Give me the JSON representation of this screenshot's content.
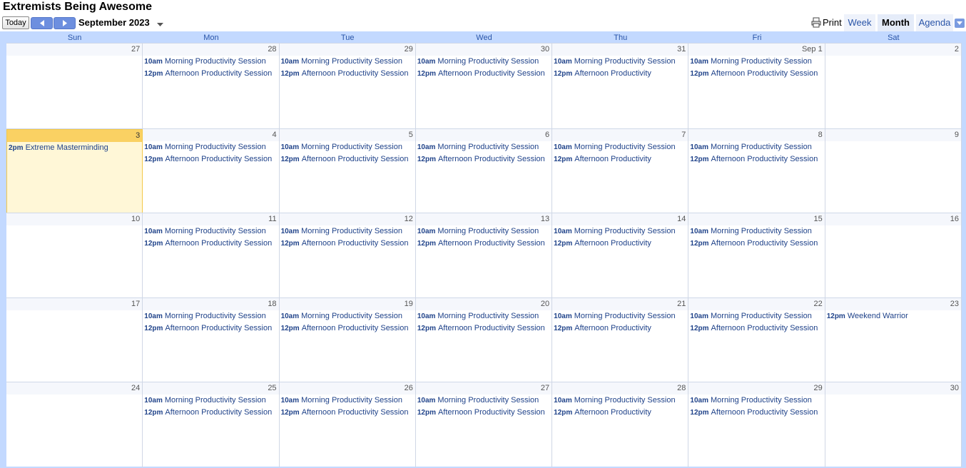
{
  "calendar_title": "Extremists Being Awesome",
  "toolbar": {
    "today": "Today",
    "date_label": "September 2023",
    "print": "Print",
    "tab_week": "Week",
    "tab_month": "Month",
    "tab_agenda": "Agenda"
  },
  "days_of_week": [
    "Sun",
    "Mon",
    "Tue",
    "Wed",
    "Thu",
    "Fri",
    "Sat"
  ],
  "weeks": [
    {
      "dates": [
        "27",
        "28",
        "29",
        "30",
        "31",
        "Sep 1",
        "2"
      ],
      "events": [
        [],
        [
          {
            "time": "10am",
            "title": "Morning Productivity Session"
          },
          {
            "time": "12pm",
            "title": "Afternoon Productivity Session"
          }
        ],
        [
          {
            "time": "10am",
            "title": "Morning Productivity Session"
          },
          {
            "time": "12pm",
            "title": "Afternoon Productivity Session"
          }
        ],
        [
          {
            "time": "10am",
            "title": "Morning Productivity Session"
          },
          {
            "time": "12pm",
            "title": "Afternoon Productivity Session"
          }
        ],
        [
          {
            "time": "10am",
            "title": "Morning Productivity Session"
          },
          {
            "time": "12pm",
            "title": "Afternoon Productivity"
          }
        ],
        [
          {
            "time": "10am",
            "title": "Morning Productivity Session"
          },
          {
            "time": "12pm",
            "title": "Afternoon Productivity Session"
          }
        ],
        []
      ]
    },
    {
      "dates": [
        "3",
        "4",
        "5",
        "6",
        "7",
        "8",
        "9"
      ],
      "today_index": 0,
      "events": [
        [
          {
            "time": "2pm",
            "title": "Extreme Masterminding"
          }
        ],
        [
          {
            "time": "10am",
            "title": "Morning Productivity Session"
          },
          {
            "time": "12pm",
            "title": "Afternoon Productivity Session"
          }
        ],
        [
          {
            "time": "10am",
            "title": "Morning Productivity Session"
          },
          {
            "time": "12pm",
            "title": "Afternoon Productivity Session"
          }
        ],
        [
          {
            "time": "10am",
            "title": "Morning Productivity Session"
          },
          {
            "time": "12pm",
            "title": "Afternoon Productivity Session"
          }
        ],
        [
          {
            "time": "10am",
            "title": "Morning Productivity Session"
          },
          {
            "time": "12pm",
            "title": "Afternoon Productivity"
          }
        ],
        [
          {
            "time": "10am",
            "title": "Morning Productivity Session"
          },
          {
            "time": "12pm",
            "title": "Afternoon Productivity Session"
          }
        ],
        []
      ]
    },
    {
      "dates": [
        "10",
        "11",
        "12",
        "13",
        "14",
        "15",
        "16"
      ],
      "events": [
        [],
        [
          {
            "time": "10am",
            "title": "Morning Productivity Session"
          },
          {
            "time": "12pm",
            "title": "Afternoon Productivity Session"
          }
        ],
        [
          {
            "time": "10am",
            "title": "Morning Productivity Session"
          },
          {
            "time": "12pm",
            "title": "Afternoon Productivity Session"
          }
        ],
        [
          {
            "time": "10am",
            "title": "Morning Productivity Session"
          },
          {
            "time": "12pm",
            "title": "Afternoon Productivity Session"
          }
        ],
        [
          {
            "time": "10am",
            "title": "Morning Productivity Session"
          },
          {
            "time": "12pm",
            "title": "Afternoon Productivity"
          }
        ],
        [
          {
            "time": "10am",
            "title": "Morning Productivity Session"
          },
          {
            "time": "12pm",
            "title": "Afternoon Productivity Session"
          }
        ],
        []
      ]
    },
    {
      "dates": [
        "17",
        "18",
        "19",
        "20",
        "21",
        "22",
        "23"
      ],
      "events": [
        [],
        [
          {
            "time": "10am",
            "title": "Morning Productivity Session"
          },
          {
            "time": "12pm",
            "title": "Afternoon Productivity Session"
          }
        ],
        [
          {
            "time": "10am",
            "title": "Morning Productivity Session"
          },
          {
            "time": "12pm",
            "title": "Afternoon Productivity Session"
          }
        ],
        [
          {
            "time": "10am",
            "title": "Morning Productivity Session"
          },
          {
            "time": "12pm",
            "title": "Afternoon Productivity Session"
          }
        ],
        [
          {
            "time": "10am",
            "title": "Morning Productivity Session"
          },
          {
            "time": "12pm",
            "title": "Afternoon Productivity"
          }
        ],
        [
          {
            "time": "10am",
            "title": "Morning Productivity Session"
          },
          {
            "time": "12pm",
            "title": "Afternoon Productivity Session"
          }
        ],
        [
          {
            "time": "12pm",
            "title": "Weekend Warrior"
          }
        ]
      ]
    },
    {
      "dates": [
        "24",
        "25",
        "26",
        "27",
        "28",
        "29",
        "30"
      ],
      "events": [
        [],
        [
          {
            "time": "10am",
            "title": "Morning Productivity Session"
          },
          {
            "time": "12pm",
            "title": "Afternoon Productivity Session"
          }
        ],
        [
          {
            "time": "10am",
            "title": "Morning Productivity Session"
          },
          {
            "time": "12pm",
            "title": "Afternoon Productivity Session"
          }
        ],
        [
          {
            "time": "10am",
            "title": "Morning Productivity Session"
          },
          {
            "time": "12pm",
            "title": "Afternoon Productivity Session"
          }
        ],
        [
          {
            "time": "10am",
            "title": "Morning Productivity Session"
          },
          {
            "time": "12pm",
            "title": "Afternoon Productivity"
          }
        ],
        [
          {
            "time": "10am",
            "title": "Morning Productivity Session"
          },
          {
            "time": "12pm",
            "title": "Afternoon Productivity Session"
          }
        ],
        []
      ]
    }
  ]
}
